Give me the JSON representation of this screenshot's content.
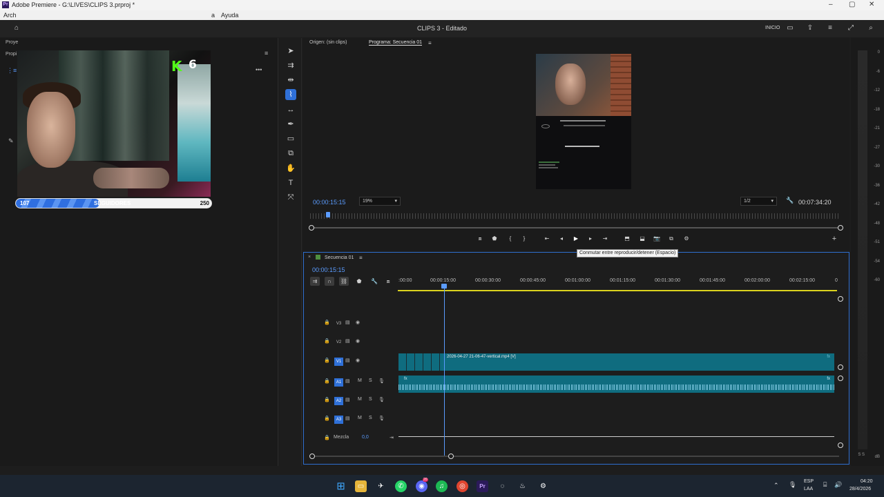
{
  "window": {
    "app_icon": "Pr",
    "title": "Adobe Premiere - G:\\LIVES\\CLIPS 3.prproj *",
    "minimize": "–",
    "maximize": "▢",
    "close": "✕"
  },
  "menubar": {
    "items": [
      "Arch",
      "a",
      "Ayuda"
    ]
  },
  "header": {
    "title": "CLIPS 3 - Editado",
    "workspace_label": "INICIO"
  },
  "left_panel": {
    "tabs": [
      "Proye",
      "Propi"
    ],
    "overlay": {
      "kick_icon": "K",
      "kick_count": "6",
      "followers_current": "107",
      "followers_label": "SEGUIDORES",
      "followers_goal": "250",
      "followers_progress": 0.428
    }
  },
  "toolbar": {
    "tools": [
      "selection-icon",
      "track-select-icon",
      "ripple-edit-icon",
      "razor-icon",
      "slip-icon",
      "pen-icon",
      "rectangle-icon",
      "type-icon-2",
      "hand-icon",
      "text-icon",
      "remix-icon"
    ]
  },
  "program_monitor": {
    "source_tab": "Origen: (sin clips)",
    "program_tab": "Programa: Secuencia 01",
    "current_time": "00:00:15:15",
    "zoom": "19%",
    "resolution": "1/2",
    "duration": "00:07:34:20",
    "tooltip": "Conmutar entre reproducir/detener (Espacio)"
  },
  "timeline": {
    "tab": "Secuencia 01",
    "current_time": "00:00:15:15",
    "ruler_ticks": [
      ":00:00",
      "00:00:15:00",
      "00:00:30:00",
      "00:00:45:00",
      "00:01:00:00",
      "00:01:15:00",
      "00:01:30:00",
      "00:01:45:00",
      "00:02:00:00",
      "00:02:15:00",
      "0"
    ],
    "tracks": [
      {
        "label": "V3",
        "type": "video"
      },
      {
        "label": "V2",
        "type": "video"
      },
      {
        "label": "V1",
        "type": "video"
      },
      {
        "label": "A1",
        "type": "audio"
      },
      {
        "label": "A2",
        "type": "audio"
      },
      {
        "label": "A3",
        "type": "audio"
      }
    ],
    "track_m": "M",
    "track_s": "S",
    "mix_label": "Mezcla",
    "mix_value": "0,0",
    "clip_name": "2026-04-27 21-06-47-vertical.mp4 [V]",
    "fx": "fx"
  },
  "meters": {
    "db_labels": [
      "0",
      "-6",
      "-12",
      "-18",
      "-21",
      "-27",
      "-30",
      "-36",
      "-42",
      "-48",
      "-51",
      "-54",
      "-60"
    ],
    "db_unit": "dB",
    "solo": "S S"
  },
  "taskbar": {
    "lang": "ESP",
    "region": "LAA",
    "time": "04:20",
    "date": "28/4/2026",
    "discord_badge": "20"
  }
}
